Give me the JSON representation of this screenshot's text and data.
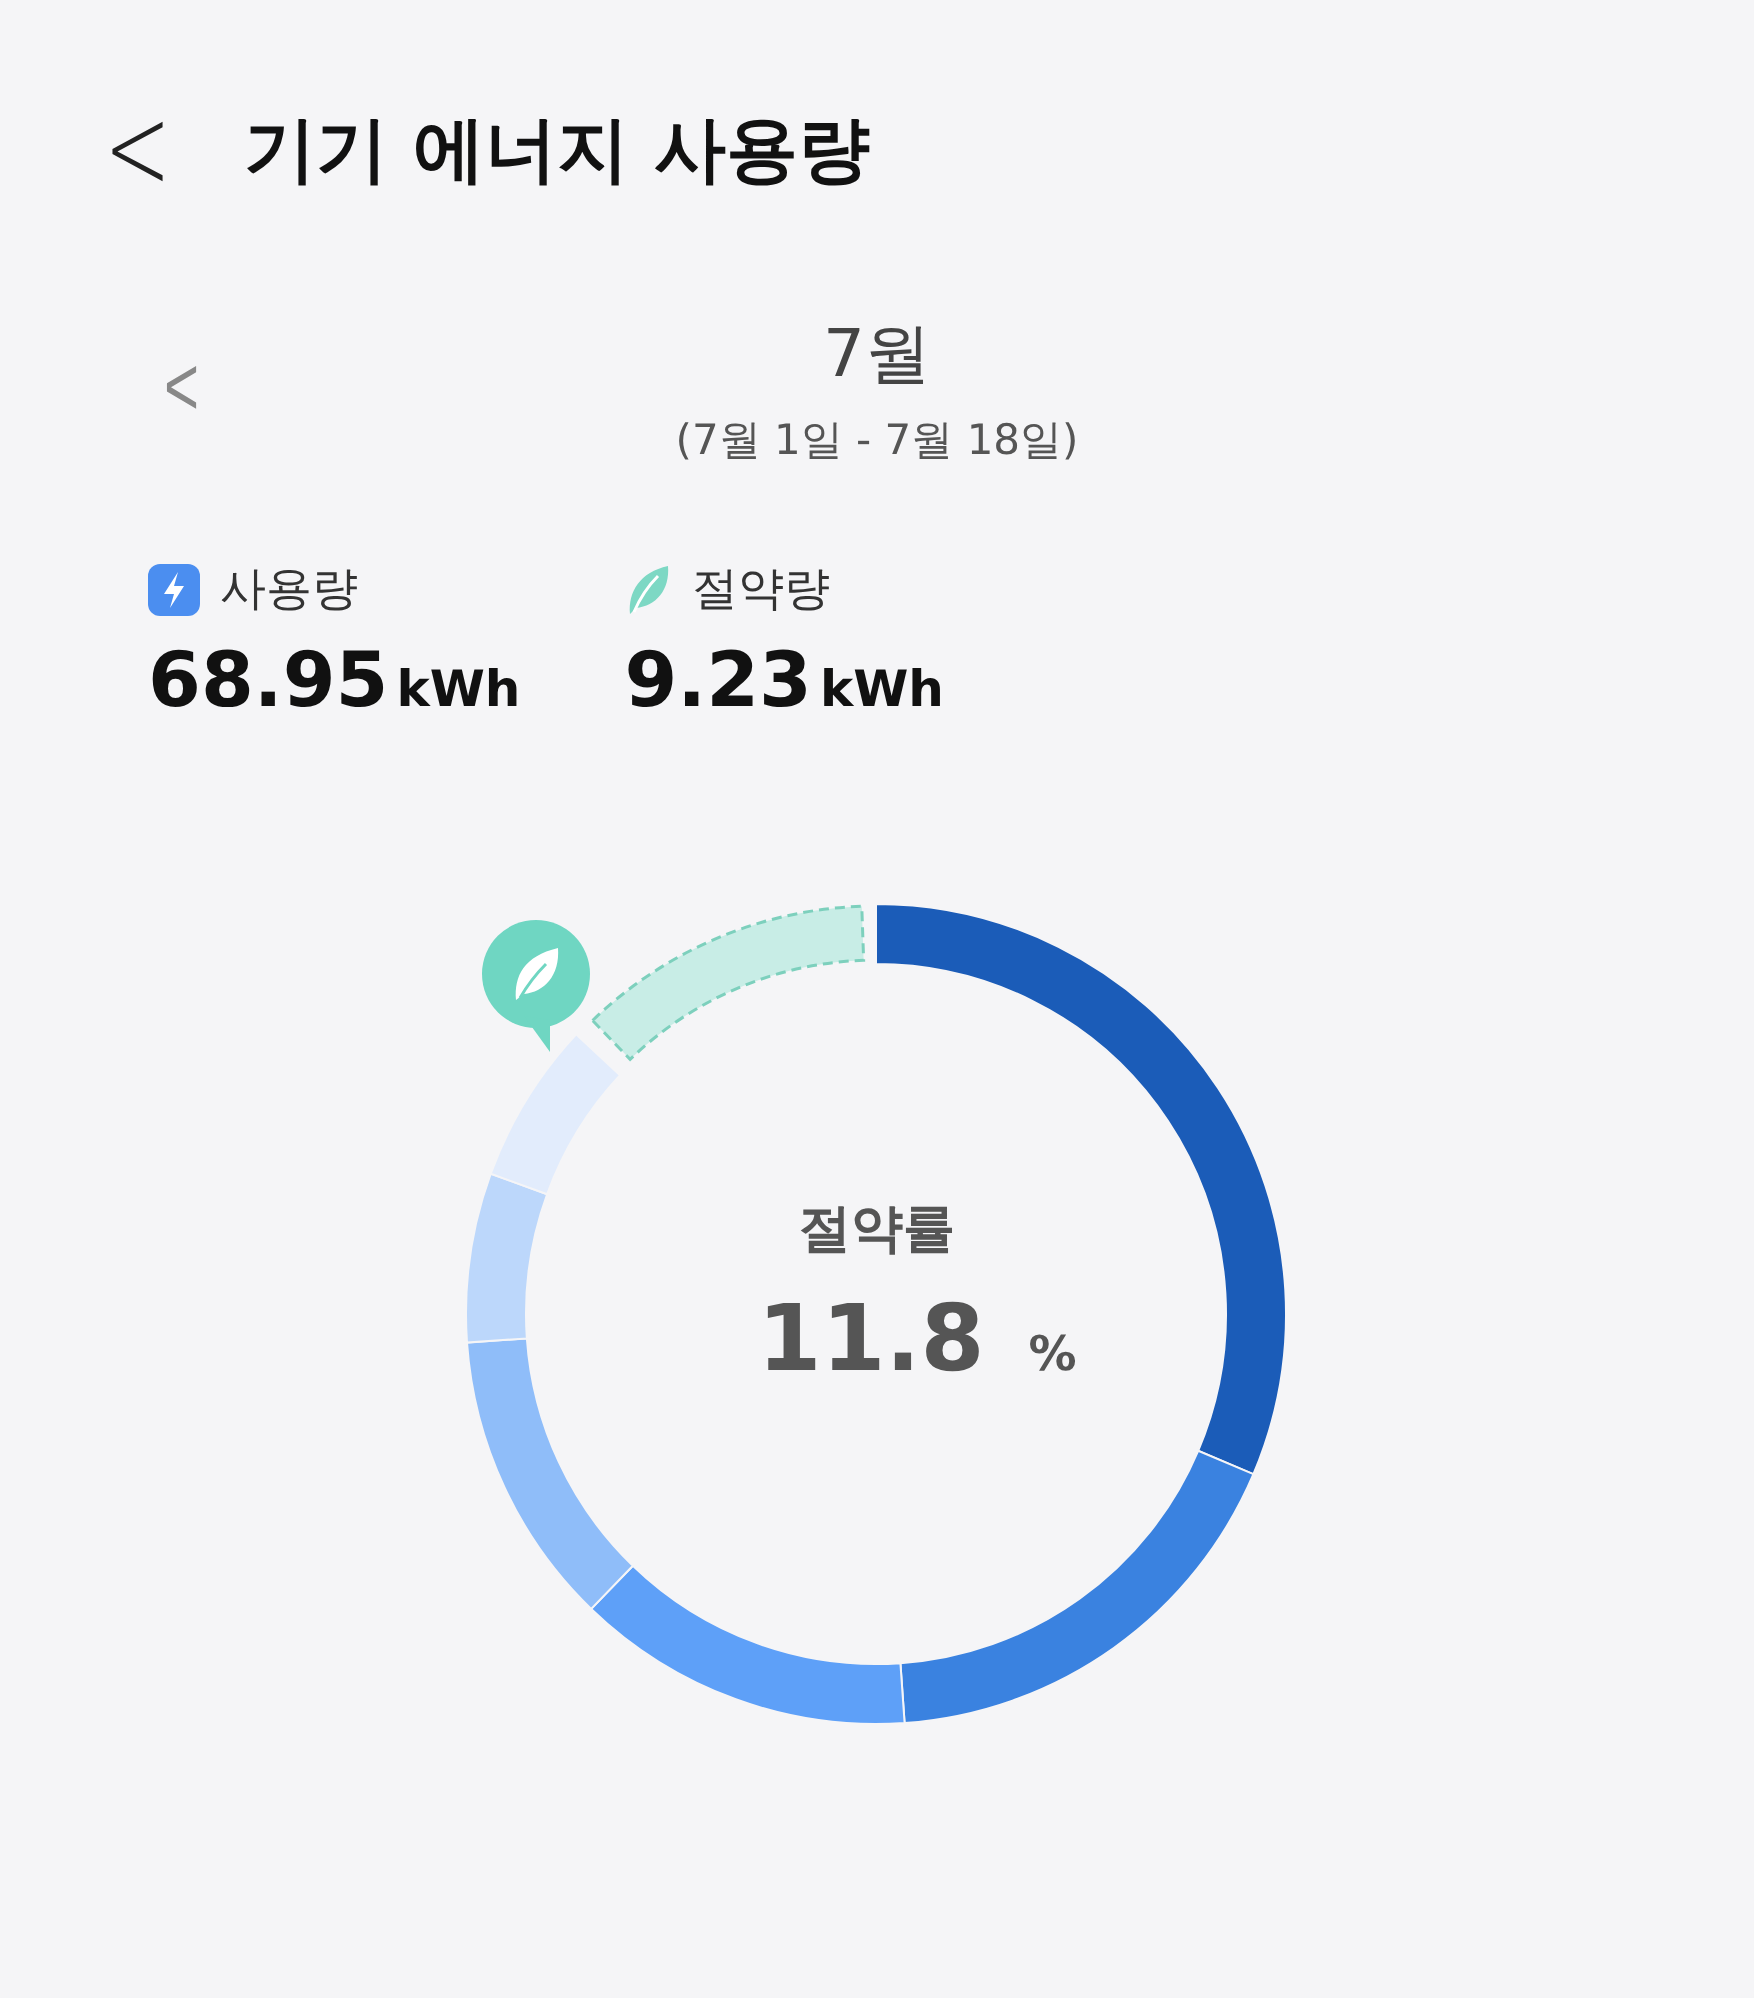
{
  "header": {
    "back": "<",
    "title": "기기 에너지 사용량"
  },
  "period": {
    "prev": "<",
    "month": "7월",
    "range": "(7월 1일 - 7월 18일)"
  },
  "stats": [
    {
      "kind": "usage",
      "label": "사용량",
      "value": "68.95",
      "unit": "kWh"
    },
    {
      "kind": "saving",
      "label": "절약량",
      "value": "9.23",
      "unit": "kWh"
    }
  ],
  "ring": {
    "label": "절약률",
    "value": "11.8",
    "unit": "%"
  }
}
